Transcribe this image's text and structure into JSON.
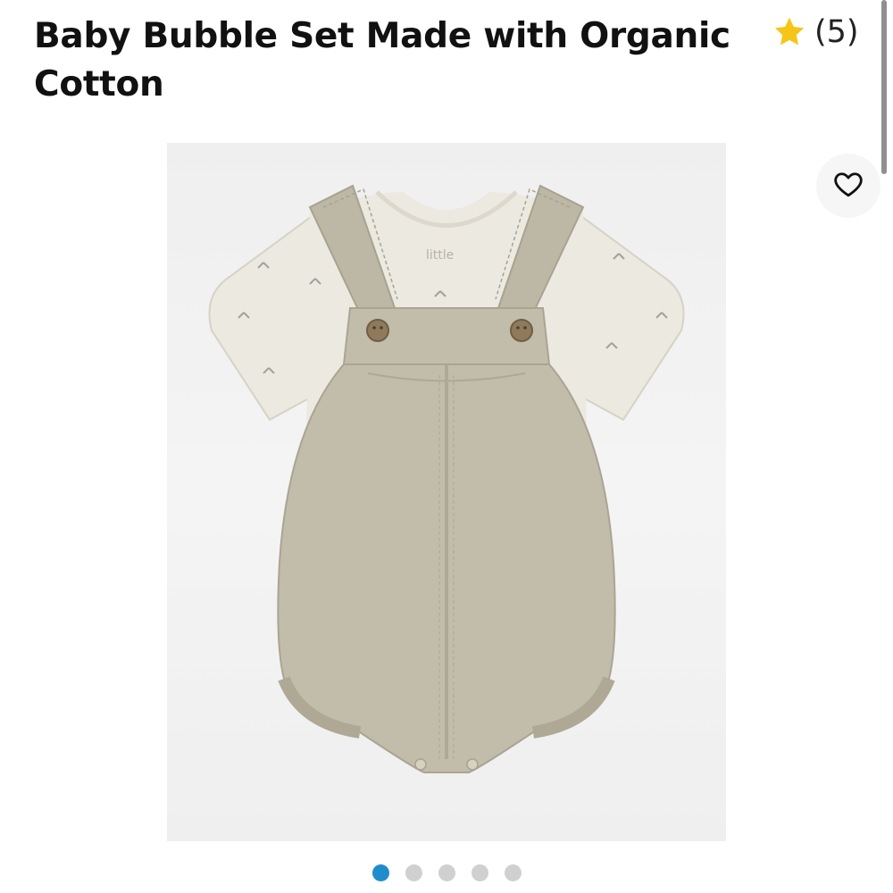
{
  "product": {
    "title": "Baby Bubble Set Made with Organic Cotton",
    "rating_icon": "star-icon",
    "rating_count": "(5)"
  },
  "favorite": {
    "icon": "heart-icon"
  },
  "image": {
    "garment_label": "little"
  },
  "carousel": {
    "total": 5,
    "active_index": 0
  },
  "colors": {
    "star": "#f5c518",
    "active_dot": "#1f8ccc",
    "inactive_dot": "#d0d0d0",
    "overall_fabric": "#bfb9a8",
    "tee_fabric": "#ece9e1"
  }
}
